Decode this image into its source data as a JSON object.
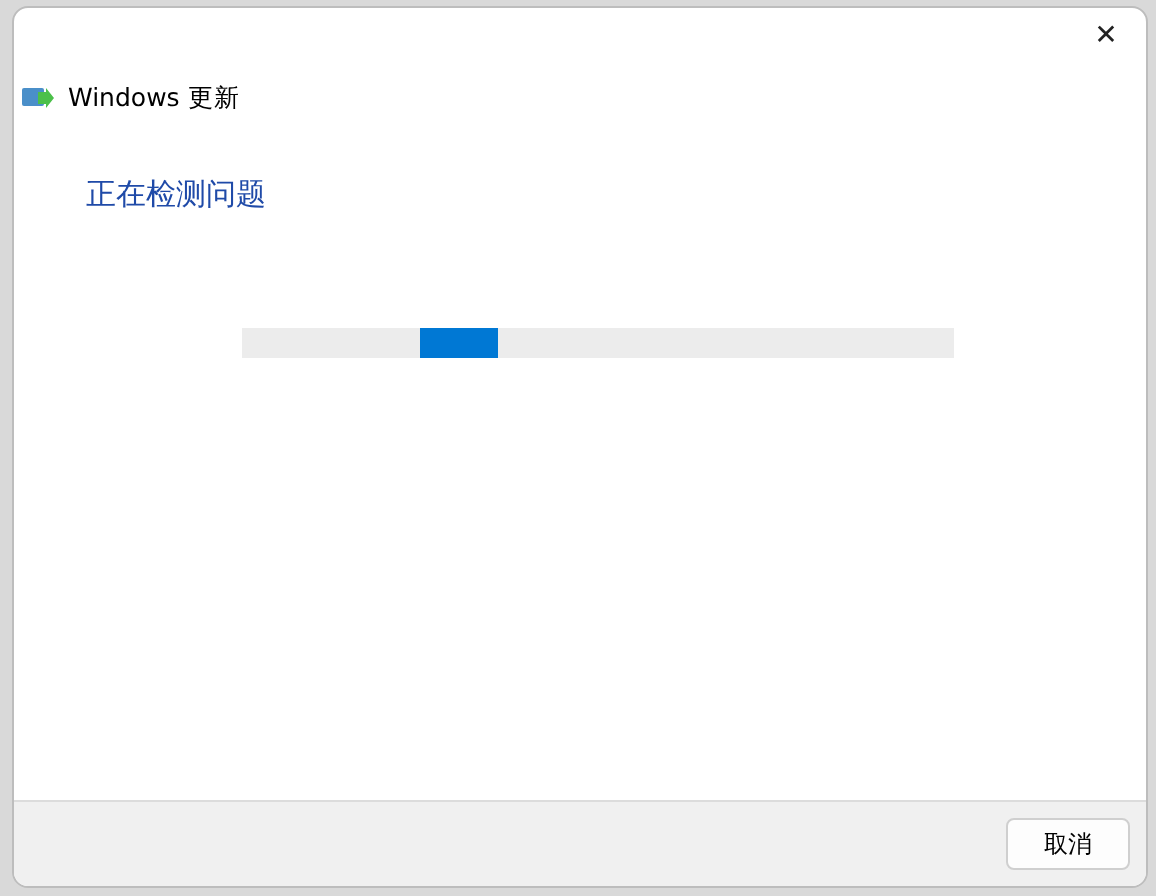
{
  "window": {
    "title": "Windows 更新",
    "close": "✕"
  },
  "heading": "正在检测问题",
  "progress": {
    "kind": "indeterminate"
  },
  "buttons": [
    {
      "label": "取消"
    }
  ]
}
